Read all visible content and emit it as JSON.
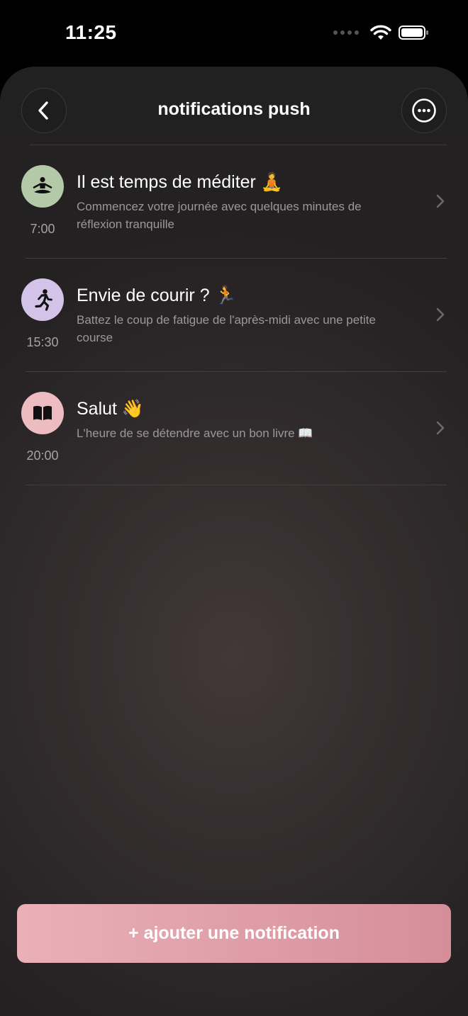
{
  "status_bar": {
    "time": "11:25",
    "icons": [
      "cellular-icon",
      "wifi-icon",
      "battery-icon"
    ]
  },
  "header": {
    "title": "notifications push",
    "back_icon": "chevron-left-icon",
    "more_icon": "ellipsis-circle-icon"
  },
  "notifications": [
    {
      "title": "Il est temps de méditer 🧘",
      "description": "Commencez votre journée avec quelques minutes de réflexion tranquille",
      "time": "7:00",
      "icon": "meditation-icon",
      "icon_bg": "#b3c9a8"
    },
    {
      "title": "Envie de courir ? 🏃",
      "description": "Battez le coup de fatigue de l'après-midi avec une petite course",
      "time": "15:30",
      "icon": "running-icon",
      "icon_bg": "#d4c3e8"
    },
    {
      "title": "Salut 👋",
      "description": "L'heure de se détendre avec un bon livre 📖",
      "time": "20:00",
      "icon": "book-icon",
      "icon_bg": "#ecbcc0"
    }
  ],
  "add_button": {
    "label": "+ ajouter une notification"
  },
  "colors": {
    "accent_start": "#eab0b7",
    "accent_end": "#d58e98",
    "background": "#242122"
  }
}
